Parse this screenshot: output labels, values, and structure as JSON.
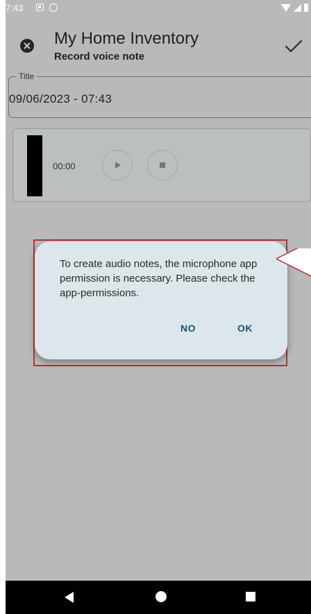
{
  "status_bar": {
    "time": "7:43",
    "icons": [
      "keyboard-icon",
      "sync-icon",
      "wifi-icon",
      "signal-icon",
      "battery-icon"
    ]
  },
  "app_bar": {
    "title": "My Home Inventory",
    "subtitle": "Record voice note",
    "close_icon": "close-icon",
    "confirm_icon": "check-icon"
  },
  "title_field": {
    "label": "Title",
    "value": "09/06/2023 - 07:43"
  },
  "audio_player": {
    "elapsed": "00:00",
    "play_icon": "play-icon",
    "stop_icon": "stop-icon"
  },
  "dialog": {
    "message": "To create audio notes, the microphone app permission is necessary. Please check the app-permissions.",
    "no_label": "NO",
    "ok_label": "OK"
  },
  "nav_bar": {
    "icons": [
      "back-icon",
      "home-icon",
      "recents-icon"
    ]
  },
  "colors": {
    "scrim_background": "#b9b9b9",
    "dialog_background": "#dde6ea",
    "dialog_button": "#14586b",
    "highlight_border": "#b3333a"
  }
}
